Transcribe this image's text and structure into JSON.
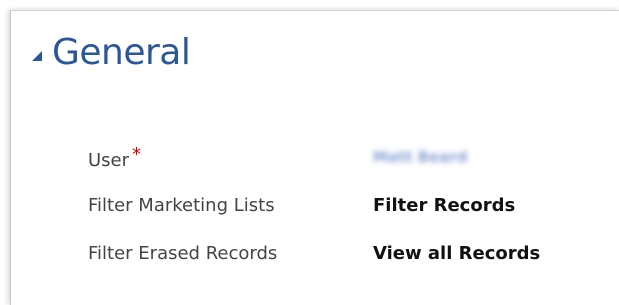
{
  "section": {
    "title": "General",
    "toggle_icon": "collapse-triangle-icon",
    "title_color": "#2b579a"
  },
  "fields": {
    "user": {
      "label": "User",
      "required_marker": "*",
      "value": "Matt Beard"
    },
    "filter_marketing_lists": {
      "label": "Filter Marketing Lists",
      "value": "Filter Records"
    },
    "filter_erased_records": {
      "label": "Filter Erased Records",
      "value": "View all Records"
    }
  }
}
